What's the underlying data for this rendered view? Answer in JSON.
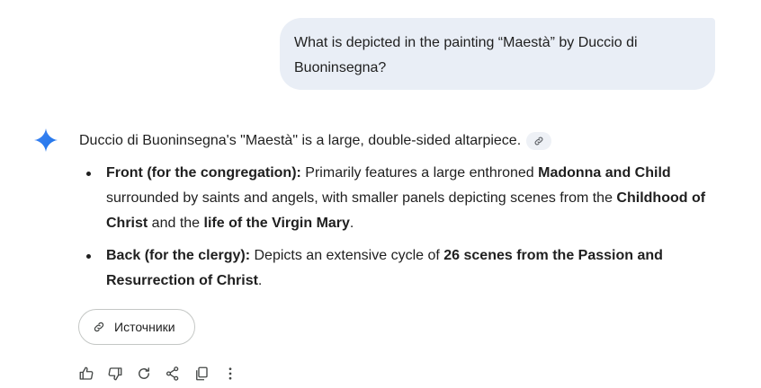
{
  "user_message": "What is depicted in the painting “Maestà” by Duccio di Buoninsegna?",
  "response": {
    "intro": "Duccio di Buoninsegna's \"Maestà\" is a large, double-sided altarpiece.",
    "points": [
      {
        "segments": [
          {
            "text": "Front (for the congregation):",
            "bold": true
          },
          {
            "text": " Primarily features a large enthroned ",
            "bold": false
          },
          {
            "text": "Madonna and Child",
            "bold": true
          },
          {
            "text": " surrounded by saints and angels, with smaller panels depicting scenes from the ",
            "bold": false
          },
          {
            "text": "Childhood of Christ",
            "bold": true
          },
          {
            "text": " and the ",
            "bold": false
          },
          {
            "text": "life of the Virgin Mary",
            "bold": true
          },
          {
            "text": ".",
            "bold": false
          }
        ]
      },
      {
        "segments": [
          {
            "text": "Back (for the clergy):",
            "bold": true
          },
          {
            "text": " Depicts an extensive cycle of ",
            "bold": false
          },
          {
            "text": "26 scenes from the Passion and Resurrection of Christ",
            "bold": true
          },
          {
            "text": ".",
            "bold": false
          }
        ]
      }
    ]
  },
  "sources_button": {
    "label": "Источники",
    "icon": "link-icon"
  },
  "action_icons": [
    "thumbs-up-icon",
    "thumbs-down-icon",
    "regenerate-icon",
    "share-icon",
    "copy-icon",
    "more-vert-icon"
  ],
  "colors": {
    "user_bubble": "#e9eef6",
    "spark_gradient_start": "#4285f4",
    "spark_gradient_end": "#9b72cb",
    "text": "#1f1f1f",
    "icon": "#444746"
  }
}
